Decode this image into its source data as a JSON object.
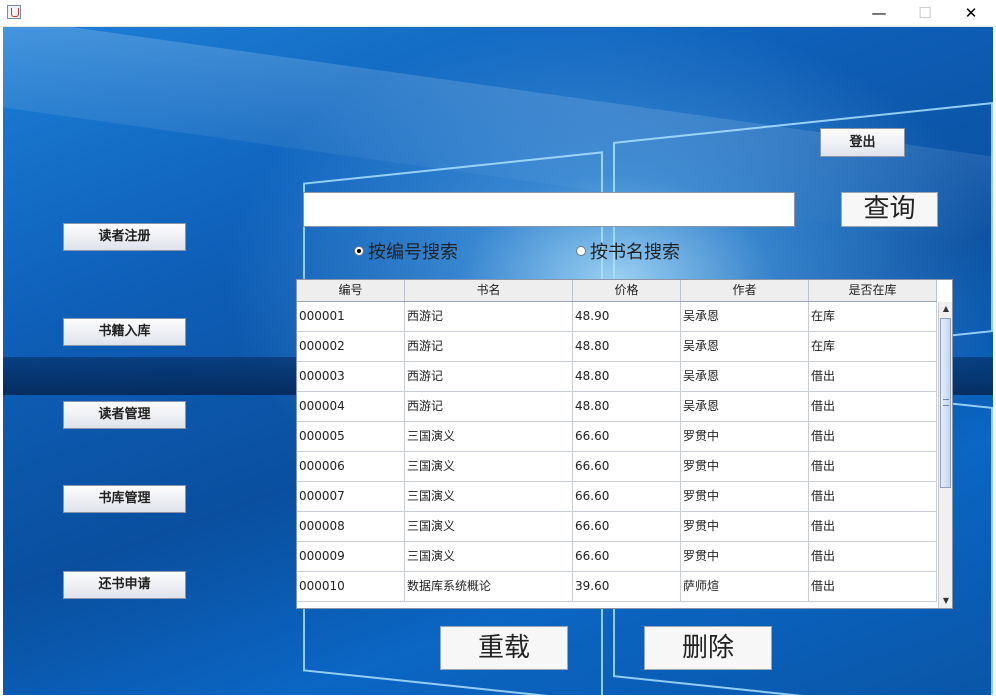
{
  "window": {
    "minimize_glyph": "—",
    "maximize_glyph": "☐",
    "close_glyph": "✕",
    "icon": "java-app-icon"
  },
  "sidebar": {
    "items": [
      {
        "label": "读者注册"
      },
      {
        "label": "书籍入库"
      },
      {
        "label": "读者管理"
      },
      {
        "label": "书库管理"
      },
      {
        "label": "还书申请"
      }
    ]
  },
  "header": {
    "logout_label": "登出"
  },
  "search": {
    "value": "",
    "query_label": "查询",
    "modes": [
      {
        "label": "按编号搜索",
        "selected": true
      },
      {
        "label": "按书名搜索",
        "selected": false
      }
    ]
  },
  "table": {
    "columns": [
      "编号",
      "书名",
      "价格",
      "作者",
      "是否在库"
    ],
    "rows": [
      [
        "000001",
        "西游记",
        "48.90",
        "吴承恩",
        "在库"
      ],
      [
        "000002",
        "西游记",
        "48.80",
        "吴承恩",
        "在库"
      ],
      [
        "000003",
        "西游记",
        "48.80",
        "吴承恩",
        "借出"
      ],
      [
        "000004",
        "西游记",
        "48.80",
        "吴承恩",
        "借出"
      ],
      [
        "000005",
        "三国演义",
        "66.60",
        "罗贯中",
        "借出"
      ],
      [
        "000006",
        "三国演义",
        "66.60",
        "罗贯中",
        "借出"
      ],
      [
        "000007",
        "三国演义",
        "66.60",
        "罗贯中",
        "借出"
      ],
      [
        "000008",
        "三国演义",
        "66.60",
        "罗贯中",
        "借出"
      ],
      [
        "000009",
        "三国演义",
        "66.60",
        "罗贯中",
        "借出"
      ],
      [
        "000010",
        "数据库系统概论",
        "39.60",
        "萨师煊",
        "借出"
      ]
    ]
  },
  "actions": {
    "reload_label": "重载",
    "delete_label": "删除"
  },
  "colors": {
    "background_blue": "#0e5fb8",
    "button_face": "#f7f7f7"
  }
}
